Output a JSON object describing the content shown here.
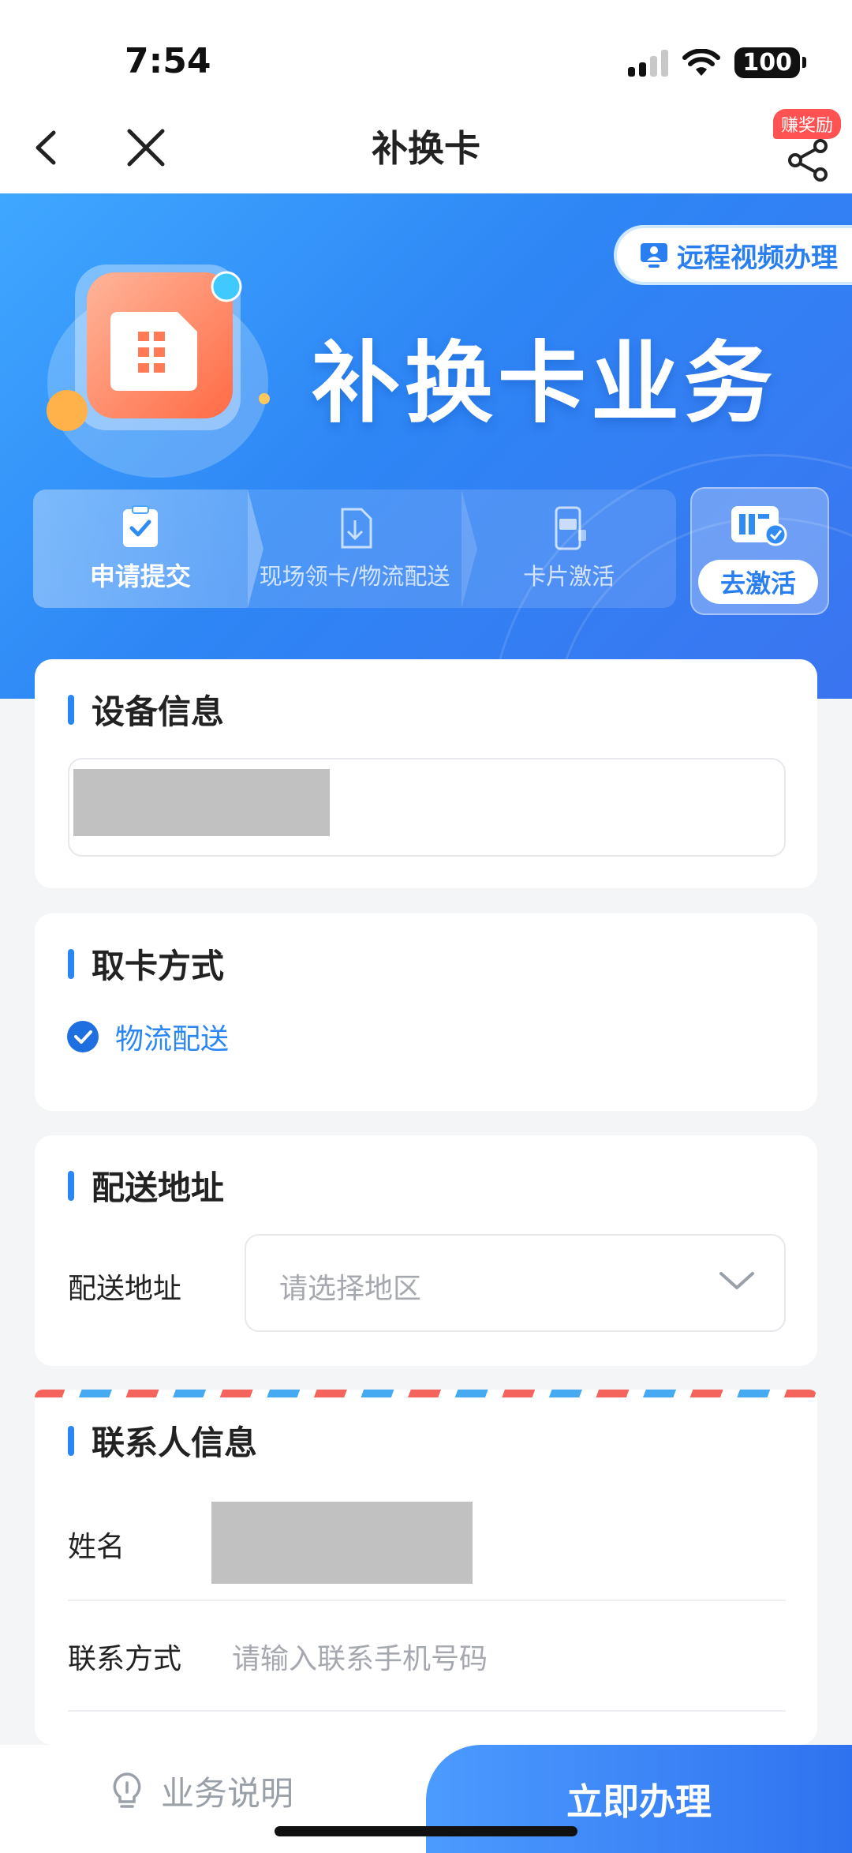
{
  "status": {
    "time": "7:54",
    "battery": "100"
  },
  "nav": {
    "title": "补换卡",
    "reward_badge": "赚奖励"
  },
  "banner": {
    "remote_button": "远程视频办理",
    "title": "补换卡业务",
    "steps": [
      {
        "label": "申请提交",
        "active": true
      },
      {
        "label": "现场领卡/物流配送",
        "active": false
      },
      {
        "label": "卡片激活",
        "active": false
      }
    ],
    "activate_button": "去激活"
  },
  "device_info": {
    "title": "设备信息"
  },
  "pickup": {
    "title": "取卡方式",
    "option": "物流配送"
  },
  "delivery": {
    "title": "配送地址",
    "label": "配送地址",
    "placeholder": "请选择地区"
  },
  "contact": {
    "title": "联系人信息",
    "name_label": "姓名",
    "phone_label": "联系方式",
    "phone_placeholder": "请输入联系手机号码"
  },
  "bottom": {
    "help_label": "业务说明",
    "apply_label": "立即办理"
  },
  "colors": {
    "accent": "#2a86f3",
    "danger": "#ff5252"
  }
}
